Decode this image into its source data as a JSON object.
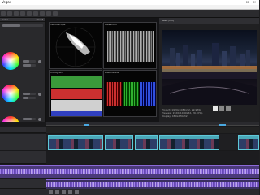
{
  "window": {
    "title": "Vegas",
    "controls": "– ☐ ✕"
  },
  "leftpanel": {
    "header": "Color",
    "right_label": "Reset"
  },
  "scopes": {
    "vectorscope": "Vectorscope",
    "waveform": "Waveform",
    "histogram": "Histogram",
    "parade": "RGB Parade"
  },
  "viewer": {
    "header": "Best (Full)",
    "info": [
      "Project: 1920x1080x32, 29.970p",
      "Preview: 1920x1080x32, 29.970p",
      "Display: 480x270x32"
    ],
    "timecode": "00:00:14;25"
  },
  "colors": {
    "accent": "#5fc8d8",
    "audio": "#8c6ad8",
    "playhead": "#d03030",
    "viewer_bg": "#202022"
  }
}
